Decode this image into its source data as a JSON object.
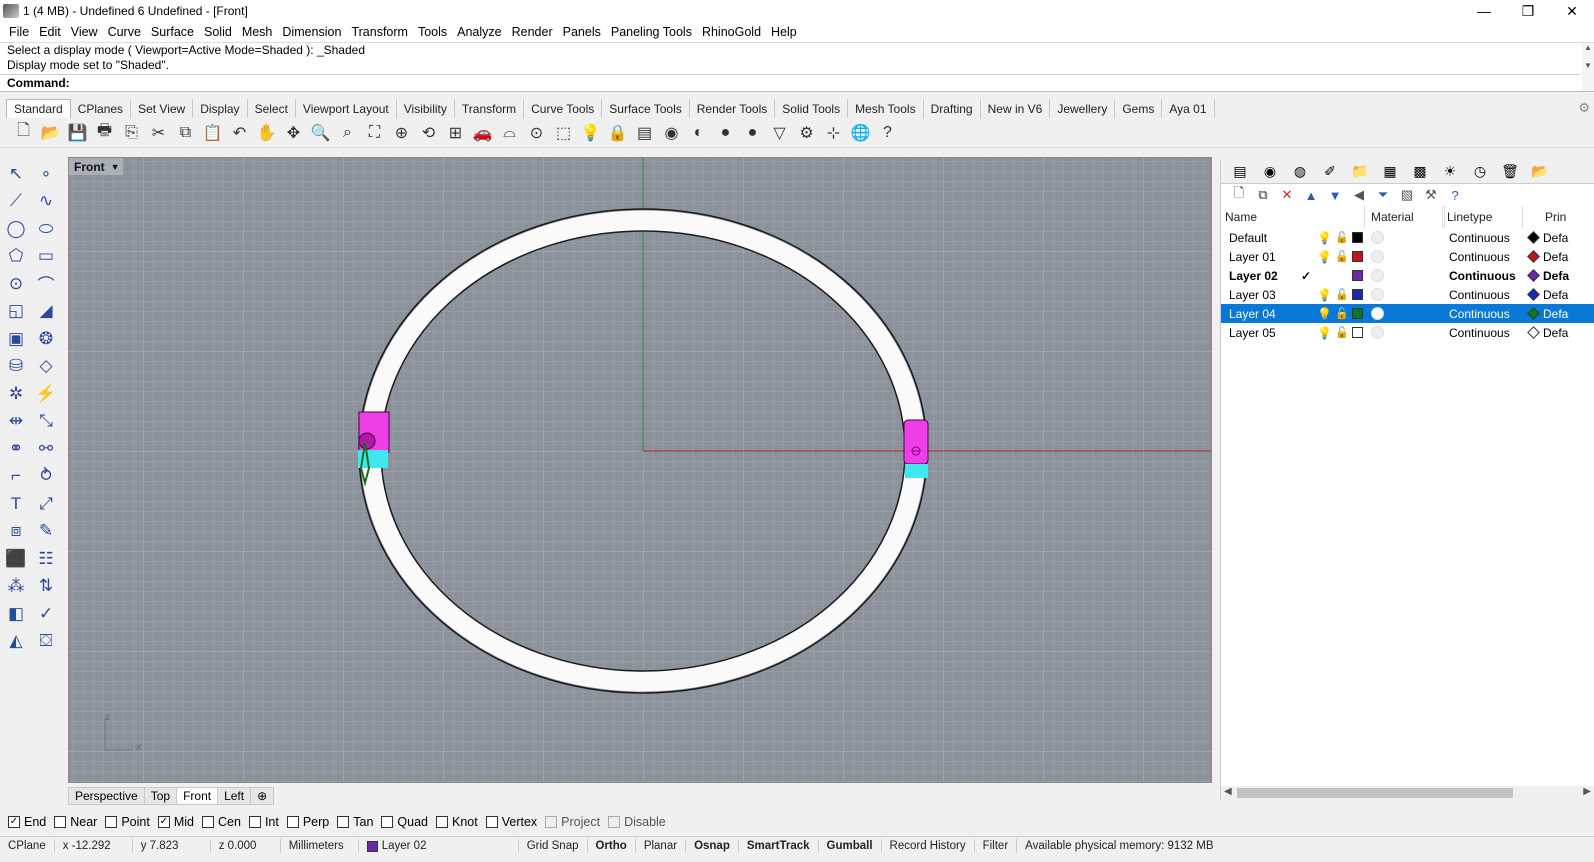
{
  "window": {
    "title": "1 (4 MB) - Undefined 6 Undefined - [Front]",
    "minimize": "—",
    "restore": "❐",
    "close": "✕"
  },
  "menu": [
    "File",
    "Edit",
    "View",
    "Curve",
    "Surface",
    "Solid",
    "Mesh",
    "Dimension",
    "Transform",
    "Tools",
    "Analyze",
    "Render",
    "Panels",
    "Paneling Tools",
    "RhinoGold",
    "Help"
  ],
  "command": {
    "history": [
      "Select a display mode ( Viewport=Active  Mode=Shaded ): _Shaded",
      "Display mode set to \"Shaded\"."
    ],
    "prompt": "Command:",
    "value": ""
  },
  "toolbar_tabs": [
    {
      "label": "Standard",
      "active": true
    },
    {
      "label": "CPlanes"
    },
    {
      "label": "Set View"
    },
    {
      "label": "Display"
    },
    {
      "label": "Select"
    },
    {
      "label": "Viewport Layout"
    },
    {
      "label": "Visibility"
    },
    {
      "label": "Transform"
    },
    {
      "label": "Curve Tools"
    },
    {
      "label": "Surface Tools"
    },
    {
      "label": "Render Tools"
    },
    {
      "label": "Solid Tools"
    },
    {
      "label": "Mesh Tools"
    },
    {
      "label": "Drafting"
    },
    {
      "label": "New in V6"
    },
    {
      "label": "Jewellery"
    },
    {
      "label": "Gems"
    },
    {
      "label": "Aya 01"
    }
  ],
  "main_tools": [
    {
      "name": "new-file-icon",
      "glyph": "🗋"
    },
    {
      "name": "open-folder-icon",
      "glyph": "📂"
    },
    {
      "name": "save-icon",
      "glyph": "💾"
    },
    {
      "name": "print-icon",
      "glyph": "🖶"
    },
    {
      "name": "import-icon",
      "glyph": "⎘"
    },
    {
      "name": "cut-icon",
      "glyph": "✂"
    },
    {
      "name": "copy-icon",
      "glyph": "⧉"
    },
    {
      "name": "paste-icon",
      "glyph": "📋"
    },
    {
      "name": "undo-icon",
      "glyph": "↶"
    },
    {
      "name": "pan-hand-icon",
      "glyph": "✋"
    },
    {
      "name": "rotate-view-icon",
      "glyph": "✥"
    },
    {
      "name": "zoom-icon",
      "glyph": "🔍"
    },
    {
      "name": "zoom-window-icon",
      "glyph": "⌕"
    },
    {
      "name": "zoom-extents-icon",
      "glyph": "⛶"
    },
    {
      "name": "zoom-selected-icon",
      "glyph": "⊕"
    },
    {
      "name": "undo-view-icon",
      "glyph": "⟲"
    },
    {
      "name": "viewport-layout-icon",
      "glyph": "⊞"
    },
    {
      "name": "car-icon",
      "glyph": "🚗"
    },
    {
      "name": "cplane-icon",
      "glyph": "⌓"
    },
    {
      "name": "target-icon",
      "glyph": "⊙"
    },
    {
      "name": "osnap-icon",
      "glyph": "⬚"
    },
    {
      "name": "light-bulb-icon",
      "glyph": "💡"
    },
    {
      "name": "lock-icon",
      "glyph": "🔒"
    },
    {
      "name": "layers-icon",
      "glyph": "▤"
    },
    {
      "name": "color-wheel-icon",
      "glyph": "◉"
    },
    {
      "name": "sphere-grey-icon",
      "glyph": "◐"
    },
    {
      "name": "shaded-sphere-icon",
      "glyph": "●"
    },
    {
      "name": "render-sphere-icon",
      "glyph": "●"
    },
    {
      "name": "lamp-icon",
      "glyph": "▽"
    },
    {
      "name": "gear-icon",
      "glyph": "⚙"
    },
    {
      "name": "gumball-icon",
      "glyph": "⊹"
    },
    {
      "name": "globe-icon",
      "glyph": "🌐"
    },
    {
      "name": "help-icon",
      "glyph": "?"
    }
  ],
  "left_tools": [
    {
      "name": "select-arrow-icon",
      "glyph": "↖"
    },
    {
      "name": "point-icon",
      "glyph": "∘"
    },
    {
      "name": "polyline-icon",
      "glyph": "⟋"
    },
    {
      "name": "curve-icon",
      "glyph": "∿"
    },
    {
      "name": "circle-icon",
      "glyph": "◯"
    },
    {
      "name": "ellipse-icon",
      "glyph": "⬭"
    },
    {
      "name": "polygon-icon",
      "glyph": "⬠"
    },
    {
      "name": "rectangle-icon",
      "glyph": "▭"
    },
    {
      "name": "circle-center-icon",
      "glyph": "⊙"
    },
    {
      "name": "arc-icon",
      "glyph": "⌒"
    },
    {
      "name": "surface-icon",
      "glyph": "◱"
    },
    {
      "name": "loft-icon",
      "glyph": "◢"
    },
    {
      "name": "box-icon",
      "glyph": "▣"
    },
    {
      "name": "boolean-icon",
      "glyph": "❂"
    },
    {
      "name": "cylinder-icon",
      "glyph": "⛁"
    },
    {
      "name": "mesh-plane-icon",
      "glyph": "◇"
    },
    {
      "name": "explode-icon",
      "glyph": "✲"
    },
    {
      "name": "snap-icon",
      "glyph": "⚡"
    },
    {
      "name": "move-icon",
      "glyph": "⇹"
    },
    {
      "name": "scale-icon",
      "glyph": "⤡"
    },
    {
      "name": "group-icon",
      "glyph": "⚭"
    },
    {
      "name": "join-icon",
      "glyph": "⚯"
    },
    {
      "name": "fillet-icon",
      "glyph": "⌐"
    },
    {
      "name": "offset-icon",
      "glyph": "⥁"
    },
    {
      "name": "text-icon",
      "glyph": "T"
    },
    {
      "name": "dimension-icon",
      "glyph": "⤢"
    },
    {
      "name": "block-icon",
      "glyph": "⧈"
    },
    {
      "name": "edit-icon",
      "glyph": "✎"
    },
    {
      "name": "solid-box-icon",
      "glyph": "⬛"
    },
    {
      "name": "array-icon",
      "glyph": "☷"
    },
    {
      "name": "grid-array-icon",
      "glyph": "⁂"
    },
    {
      "name": "distance-icon",
      "glyph": "⇅"
    },
    {
      "name": "analyze-icon",
      "glyph": "◧"
    },
    {
      "name": "check-icon",
      "glyph": "✓"
    },
    {
      "name": "render-icon",
      "glyph": "◭"
    },
    {
      "name": "paint-bucket-icon",
      "glyph": "⛋"
    }
  ],
  "viewport": {
    "name": "Front",
    "axis_x": "x",
    "axis_z": "z"
  },
  "viewport_tabs": [
    {
      "label": "Perspective"
    },
    {
      "label": "Top"
    },
    {
      "label": "Front",
      "active": true
    },
    {
      "label": "Left"
    },
    {
      "label": "⊕"
    }
  ],
  "panel_tabs": [
    {
      "name": "layers-tab-icon",
      "glyph": "▤"
    },
    {
      "name": "color-tab-icon",
      "glyph": "◉"
    },
    {
      "name": "materials-tab-icon",
      "glyph": "◍"
    },
    {
      "name": "display-tab-icon",
      "glyph": "✐"
    },
    {
      "name": "files-tab-icon",
      "glyph": "📁"
    },
    {
      "name": "render-tab-icon",
      "glyph": "▦"
    },
    {
      "name": "rhinogold-tab-icon",
      "glyph": "▩"
    },
    {
      "name": "lights-tab-icon",
      "glyph": "☀"
    },
    {
      "name": "history-tab-icon",
      "glyph": "◷"
    },
    {
      "name": "trash-tab-icon",
      "glyph": "🗑"
    },
    {
      "name": "folder-tab-icon",
      "glyph": "📂"
    }
  ],
  "layer_tools": [
    {
      "name": "new-layer-icon",
      "glyph": "🗋",
      "color": "#333"
    },
    {
      "name": "new-sublayer-icon",
      "glyph": "⧉",
      "color": "#333"
    },
    {
      "name": "delete-layer-icon",
      "glyph": "✕",
      "color": "#d0202a"
    },
    {
      "name": "move-up-icon",
      "glyph": "▲",
      "color": "#2a5db0"
    },
    {
      "name": "move-down-icon",
      "glyph": "▼",
      "color": "#2a5db0"
    },
    {
      "name": "move-parent-icon",
      "glyph": "◀",
      "color": "#555"
    },
    {
      "name": "filter-icon",
      "glyph": "⏷",
      "color": "#2a5db0"
    },
    {
      "name": "layer-state-icon",
      "glyph": "▧",
      "color": "#555"
    },
    {
      "name": "tools-icon",
      "glyph": "⚒",
      "color": "#555"
    },
    {
      "name": "help-icon",
      "glyph": "?",
      "color": "#2a5db0"
    }
  ],
  "layers": {
    "columns": [
      "Name",
      "Material",
      "Linetype",
      "Prin"
    ],
    "rows": [
      {
        "name": "Default",
        "color": "#000000",
        "linetype": "Continuous",
        "print": "Defa",
        "print_color": "#000000",
        "visible": true,
        "unlocked": true
      },
      {
        "name": "Layer 01",
        "color": "#c0141c",
        "linetype": "Continuous",
        "print": "Defa",
        "print_color": "#c0141c",
        "visible": true,
        "unlocked": true
      },
      {
        "name": "Layer 02",
        "color": "#6a2aa6",
        "linetype": "Continuous",
        "print": "Defa",
        "print_color": "#6a2aa6",
        "current": true,
        "check": "✓"
      },
      {
        "name": "Layer 03",
        "color": "#1a2ab0",
        "linetype": "Continuous",
        "print": "Defa",
        "print_color": "#1a2ab0",
        "visible": true,
        "unlocked": true
      },
      {
        "name": "Layer 04",
        "color": "#0a7a20",
        "linetype": "Continuous",
        "print": "Defa",
        "print_color": "#0a7a20",
        "visible": true,
        "unlocked": true,
        "selected": true
      },
      {
        "name": "Layer 05",
        "color": "#ffffff",
        "linetype": "Continuous",
        "print": "Defa",
        "print_color": "#ffffff",
        "visible": true,
        "unlocked": true
      }
    ]
  },
  "osnaps": [
    {
      "label": "End",
      "checked": true
    },
    {
      "label": "Near",
      "checked": false
    },
    {
      "label": "Point",
      "checked": false
    },
    {
      "label": "Mid",
      "checked": true
    },
    {
      "label": "Cen",
      "checked": false
    },
    {
      "label": "Int",
      "checked": false
    },
    {
      "label": "Perp",
      "checked": false
    },
    {
      "label": "Tan",
      "checked": false
    },
    {
      "label": "Quad",
      "checked": false
    },
    {
      "label": "Knot",
      "checked": false
    },
    {
      "label": "Vertex",
      "checked": false
    },
    {
      "label": "Project",
      "checked": false,
      "disabled": true
    },
    {
      "label": "Disable",
      "checked": false,
      "disabled": true
    }
  ],
  "status": {
    "cplane": "CPlane",
    "x": "x -12.292",
    "y": "y 7.823",
    "z": "z 0.000",
    "units": "Millimeters",
    "layer": "Layer 02",
    "layer_color": "#6a2aa6",
    "grid_snap": "Grid Snap",
    "ortho": "Ortho",
    "planar": "Planar",
    "osnap": "Osnap",
    "smarttrack": "SmartTrack",
    "gumball": "Gumball",
    "record_history": "Record History",
    "filter": "Filter",
    "memory": "Available physical memory: 9132 MB"
  }
}
